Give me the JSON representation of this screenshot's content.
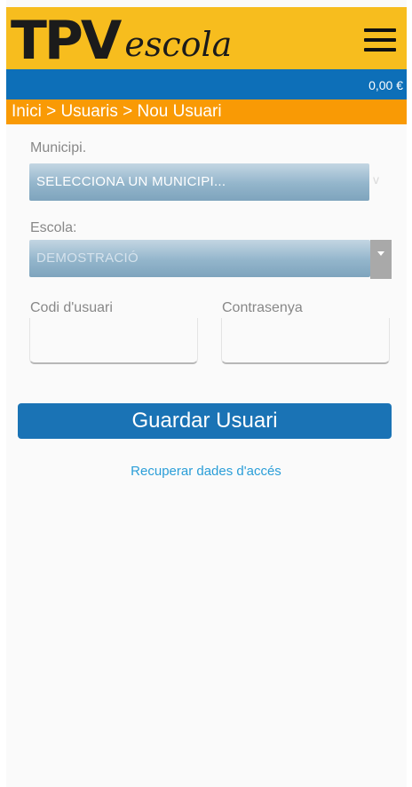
{
  "header": {
    "logo_main": "TPV",
    "logo_sub": "escola",
    "menu_icon": "hamburger-menu-icon"
  },
  "balance": "0,00 €",
  "breadcrumb": "Inici > Usuaris > Nou Usuari",
  "form": {
    "municipi_label": "Municipi.",
    "municipi_value": "SELECCIONA UN MUNICIPI...",
    "escola_label": "Escola:",
    "escola_value": "DEMOSTRACIÓ",
    "codi_label": "Codi d'usuari",
    "codi_value": "",
    "password_label": "Contrasenya",
    "password_value": ""
  },
  "save_button": "Guardar Usuari",
  "recover_link": "Recuperar dades d'accés",
  "colors": {
    "header_bg": "#f7bd1e",
    "balance_bar": "#0d6fb8",
    "breadcrumb_bg": "#f99a05",
    "button": "#1a73b5",
    "link": "#2b9ed8"
  }
}
